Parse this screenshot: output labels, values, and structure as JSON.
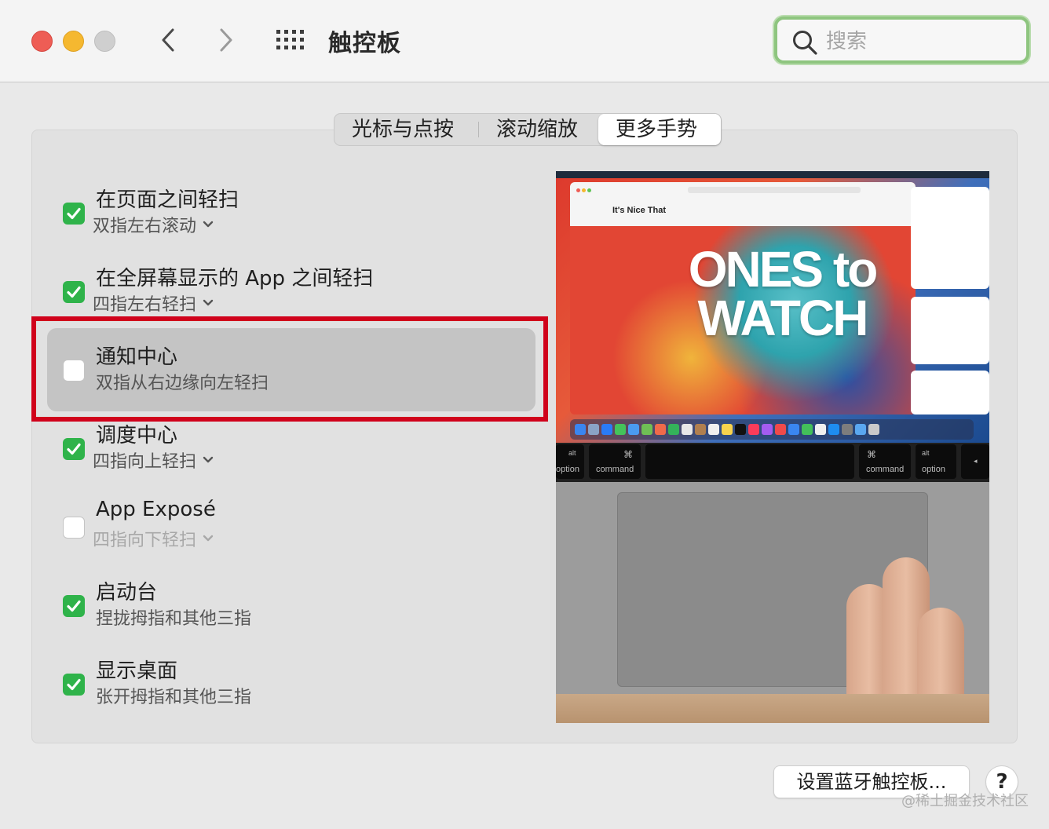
{
  "window": {
    "title": "触控板",
    "search_placeholder": "搜索"
  },
  "tabs": [
    {
      "label": "光标与点按",
      "active": false
    },
    {
      "label": "滚动缩放",
      "active": false
    },
    {
      "label": "更多手势",
      "active": true
    }
  ],
  "options": [
    {
      "title": "在页面之间轻扫",
      "subtitle": "双指左右滚动",
      "checked": true,
      "has_dropdown": true
    },
    {
      "title": "在全屏幕显示的 App 之间轻扫",
      "subtitle": "四指左右轻扫",
      "checked": true,
      "has_dropdown": true
    },
    {
      "title": "通知中心",
      "subtitle": "双指从右边缘向左轻扫",
      "checked": false,
      "has_dropdown": false,
      "highlighted": true
    },
    {
      "title": "调度中心",
      "subtitle": "四指向上轻扫",
      "checked": true,
      "has_dropdown": true
    },
    {
      "title": "App Exposé",
      "subtitle": "四指向下轻扫",
      "checked": false,
      "has_dropdown": true
    },
    {
      "title": "启动台",
      "subtitle": "捏拢拇指和其他三指",
      "checked": true,
      "has_dropdown": false
    },
    {
      "title": "显示桌面",
      "subtitle": "张开拇指和其他三指",
      "checked": true,
      "has_dropdown": false
    }
  ],
  "preview": {
    "site_name": "It's Nice That",
    "headline": "ONES to WATCH",
    "keys": {
      "left_alt": "alt",
      "left_option": "option",
      "left_cmd_symbol": "⌘",
      "left_command": "command",
      "right_cmd_symbol": "⌘",
      "right_command": "command",
      "right_alt": "alt",
      "right_option": "option"
    }
  },
  "buttons": {
    "setup_bluetooth": "设置蓝牙触控板...",
    "help": "?"
  },
  "watermark": "@稀土掘金技术社区",
  "colors": {
    "check_green": "#2fb34a",
    "highlight_red": "#d0021b",
    "search_focus": "#8ec57f"
  }
}
